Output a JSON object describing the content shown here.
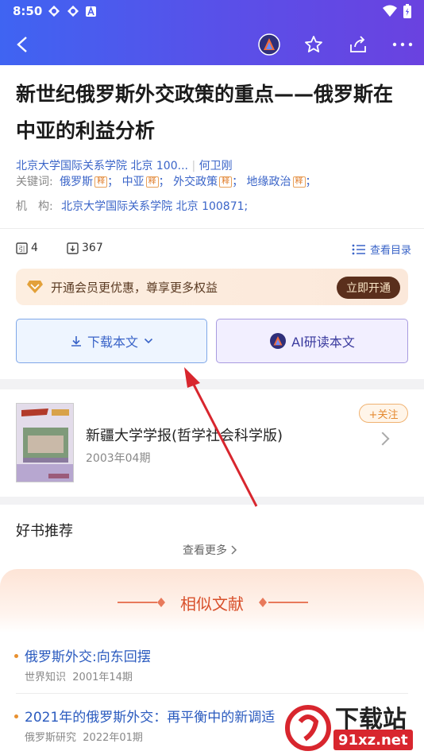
{
  "status": {
    "time": "8:50"
  },
  "article": {
    "title": "新世纪俄罗斯外交政策的重点——俄罗斯在中亚的利益分析",
    "affiliation_line": "北京大学国际关系学院 北京 100...",
    "author": "何卫刚",
    "keywords_label": "关键词:",
    "keywords": [
      "俄罗斯",
      "中亚",
      "外交政策",
      "地缘政治"
    ],
    "keyword_tag": "释",
    "institution_label": "机　构:",
    "institution": "北京大学国际关系学院 北京 100871;"
  },
  "stats": {
    "citations": "4",
    "downloads": "367",
    "toc_label": "查看目录"
  },
  "vip": {
    "text": "开通会员更优惠，尊享更多权益",
    "button": "立即开通"
  },
  "actions": {
    "download": "下载本文",
    "ai_read": "AI研读本文"
  },
  "journal": {
    "name": "新疆大学学报(哲学社会科学版)",
    "issue": "2003年04期",
    "follow": "+关注"
  },
  "books": {
    "title": "好书推荐",
    "more": "查看更多"
  },
  "similar": {
    "title": "相似文献",
    "items": [
      {
        "title": "俄罗斯外交:向东回摆",
        "source": "世界知识",
        "issue": "2001年14期"
      },
      {
        "title": "2021年的俄罗斯外交：再平衡中的新调适",
        "source": "俄罗斯研究",
        "issue": "2022年01期"
      }
    ]
  },
  "watermark": {
    "text": "下载站",
    "url": "91xz.net"
  },
  "colors": {
    "header_start": "#3f64f2",
    "header_end": "#6a42e0",
    "link": "#3a64c8",
    "accent": "#e58a31"
  }
}
